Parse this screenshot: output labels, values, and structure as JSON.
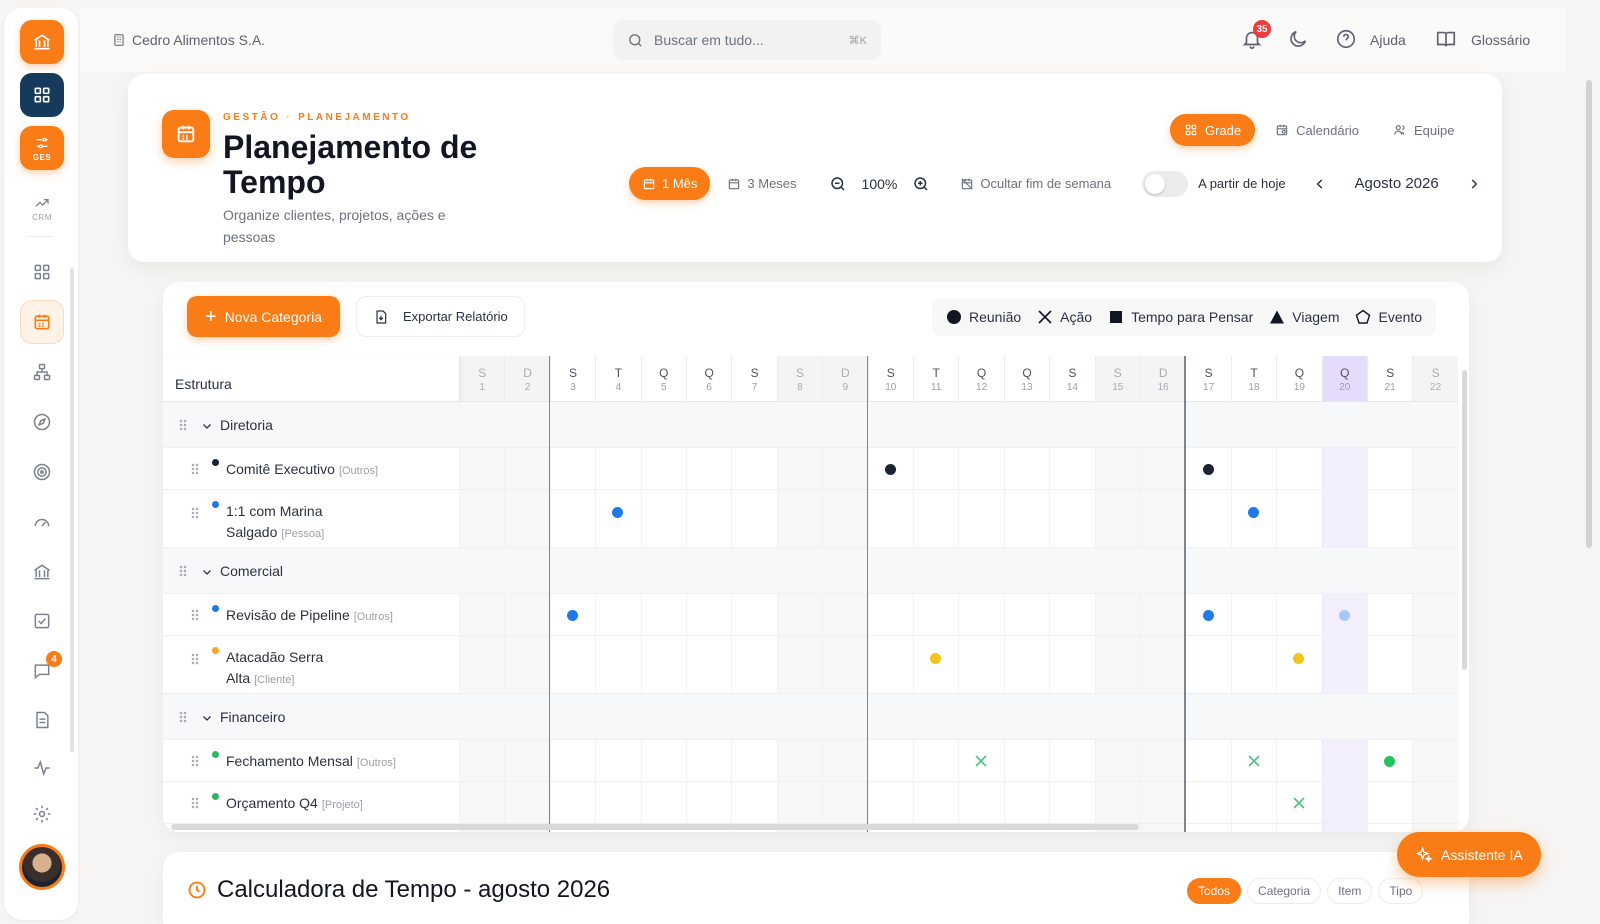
{
  "topbar": {
    "company": "Cedro Alimentos S.A.",
    "search_placeholder": "Buscar em tudo...",
    "search_shortcut": "⌘K",
    "notification_count": "35",
    "help_label": "Ajuda",
    "glossary_label": "Glossário"
  },
  "sidebar": {
    "ges_label": "GES",
    "crm_label": "CRM",
    "chat_badge": "4"
  },
  "header": {
    "breadcrumb": [
      "GESTÃO",
      "PLANEJAMENTO"
    ],
    "title": "Planejamento de Tempo",
    "subtitle": "Organize clientes, projetos, ações e pessoas",
    "view_tabs": [
      {
        "label": "Grade",
        "active": true
      },
      {
        "label": "Calendário",
        "active": false
      },
      {
        "label": "Equipe",
        "active": false
      }
    ],
    "range_options": [
      {
        "label": "1 Mês",
        "active": true
      },
      {
        "label": "3 Meses",
        "active": false
      }
    ],
    "zoom": "100%",
    "hide_weekend_label": "Ocultar fim de semana",
    "from_today_label": "A partir de hoje",
    "from_today_enabled": false,
    "month_label": "Agosto 2026"
  },
  "grid": {
    "new_category_label": "Nova Categoria",
    "export_label": "Exportar Relatório",
    "legend": [
      {
        "label": "Reunião",
        "icon": "circle"
      },
      {
        "label": "Ação",
        "icon": "x"
      },
      {
        "label": "Tempo para Pensar",
        "icon": "square"
      },
      {
        "label": "Viagem",
        "icon": "triangle"
      },
      {
        "label": "Evento",
        "icon": "pentagon"
      }
    ],
    "structure_header": "Estrutura",
    "today_day": 20,
    "days": [
      {
        "l": "S",
        "n": 1,
        "weekend": true
      },
      {
        "l": "D",
        "n": 2,
        "weekend": true
      },
      {
        "l": "S",
        "n": 3
      },
      {
        "l": "T",
        "n": 4
      },
      {
        "l": "Q",
        "n": 5
      },
      {
        "l": "Q",
        "n": 6
      },
      {
        "l": "S",
        "n": 7
      },
      {
        "l": "S",
        "n": 8,
        "weekend": true
      },
      {
        "l": "D",
        "n": 9,
        "weekend": true
      },
      {
        "l": "S",
        "n": 10
      },
      {
        "l": "T",
        "n": 11
      },
      {
        "l": "Q",
        "n": 12
      },
      {
        "l": "Q",
        "n": 13
      },
      {
        "l": "S",
        "n": 14
      },
      {
        "l": "S",
        "n": 15,
        "weekend": true
      },
      {
        "l": "D",
        "n": 16,
        "weekend": true
      },
      {
        "l": "S",
        "n": 17
      },
      {
        "l": "T",
        "n": 18
      },
      {
        "l": "Q",
        "n": 19
      },
      {
        "l": "Q",
        "n": 20
      },
      {
        "l": "S",
        "n": 21
      },
      {
        "l": "S",
        "n": 22,
        "weekend": true
      }
    ],
    "rows": [
      {
        "type": "group",
        "name": "Diretoria"
      },
      {
        "type": "item",
        "name": "Comitê Executivo",
        "tag": "[Outros]",
        "color": "#1b2233",
        "marks": [
          {
            "day": 10,
            "kind": "dot",
            "color": "#1b2233"
          },
          {
            "day": 17,
            "kind": "dot",
            "color": "#1b2233"
          }
        ]
      },
      {
        "type": "item",
        "name": "1:1 com Marina Salgado",
        "tag": "[Pessoa]",
        "color": "#1f7ae8",
        "marks": [
          {
            "day": 4,
            "kind": "dot",
            "color": "#1f7ae8"
          },
          {
            "day": 18,
            "kind": "dot",
            "color": "#1f7ae8"
          }
        ]
      },
      {
        "type": "group",
        "name": "Comercial"
      },
      {
        "type": "item",
        "name": "Revisão de Pipeline",
        "tag": "[Outros]",
        "color": "#1f7ae8",
        "marks": [
          {
            "day": 3,
            "kind": "dot",
            "color": "#1f7ae8"
          },
          {
            "day": 17,
            "kind": "dot",
            "color": "#1f7ae8"
          },
          {
            "day": 20,
            "kind": "dot",
            "color": "#a7c9f5"
          }
        ]
      },
      {
        "type": "item",
        "name": "Atacadão Serra Alta",
        "tag": "[Cliente]",
        "color": "#f5a623",
        "marks": [
          {
            "day": 11,
            "kind": "dot",
            "color": "#f2c418"
          },
          {
            "day": 19,
            "kind": "dot",
            "color": "#f2c418"
          }
        ]
      },
      {
        "type": "group",
        "name": "Financeiro"
      },
      {
        "type": "item",
        "name": "Fechamento Mensal",
        "tag": "[Outros]",
        "color": "#2bb860",
        "marks": [
          {
            "day": 12,
            "kind": "x",
            "color": "#4cc27a"
          },
          {
            "day": 18,
            "kind": "x",
            "color": "#4cc27a"
          },
          {
            "day": 21,
            "kind": "dot",
            "color": "#1fc45a"
          }
        ]
      },
      {
        "type": "item",
        "name": "Orçamento Q4",
        "tag": "[Projeto]",
        "color": "#2bb860",
        "marks": [
          {
            "day": 19,
            "kind": "x",
            "color": "#4cc27a"
          }
        ]
      }
    ]
  },
  "calculator": {
    "title": "Calculadora de Tempo - agosto 2026",
    "filters": [
      {
        "label": "Todos",
        "active": true
      },
      {
        "label": "Categoria",
        "active": false
      },
      {
        "label": "Item",
        "active": false
      },
      {
        "label": "Tipo",
        "active": false
      }
    ]
  },
  "assistant_label": "Assistente IA",
  "colors": {
    "accent": "#f97c16",
    "navy": "#163a5c",
    "today": "#e5dcfb"
  }
}
